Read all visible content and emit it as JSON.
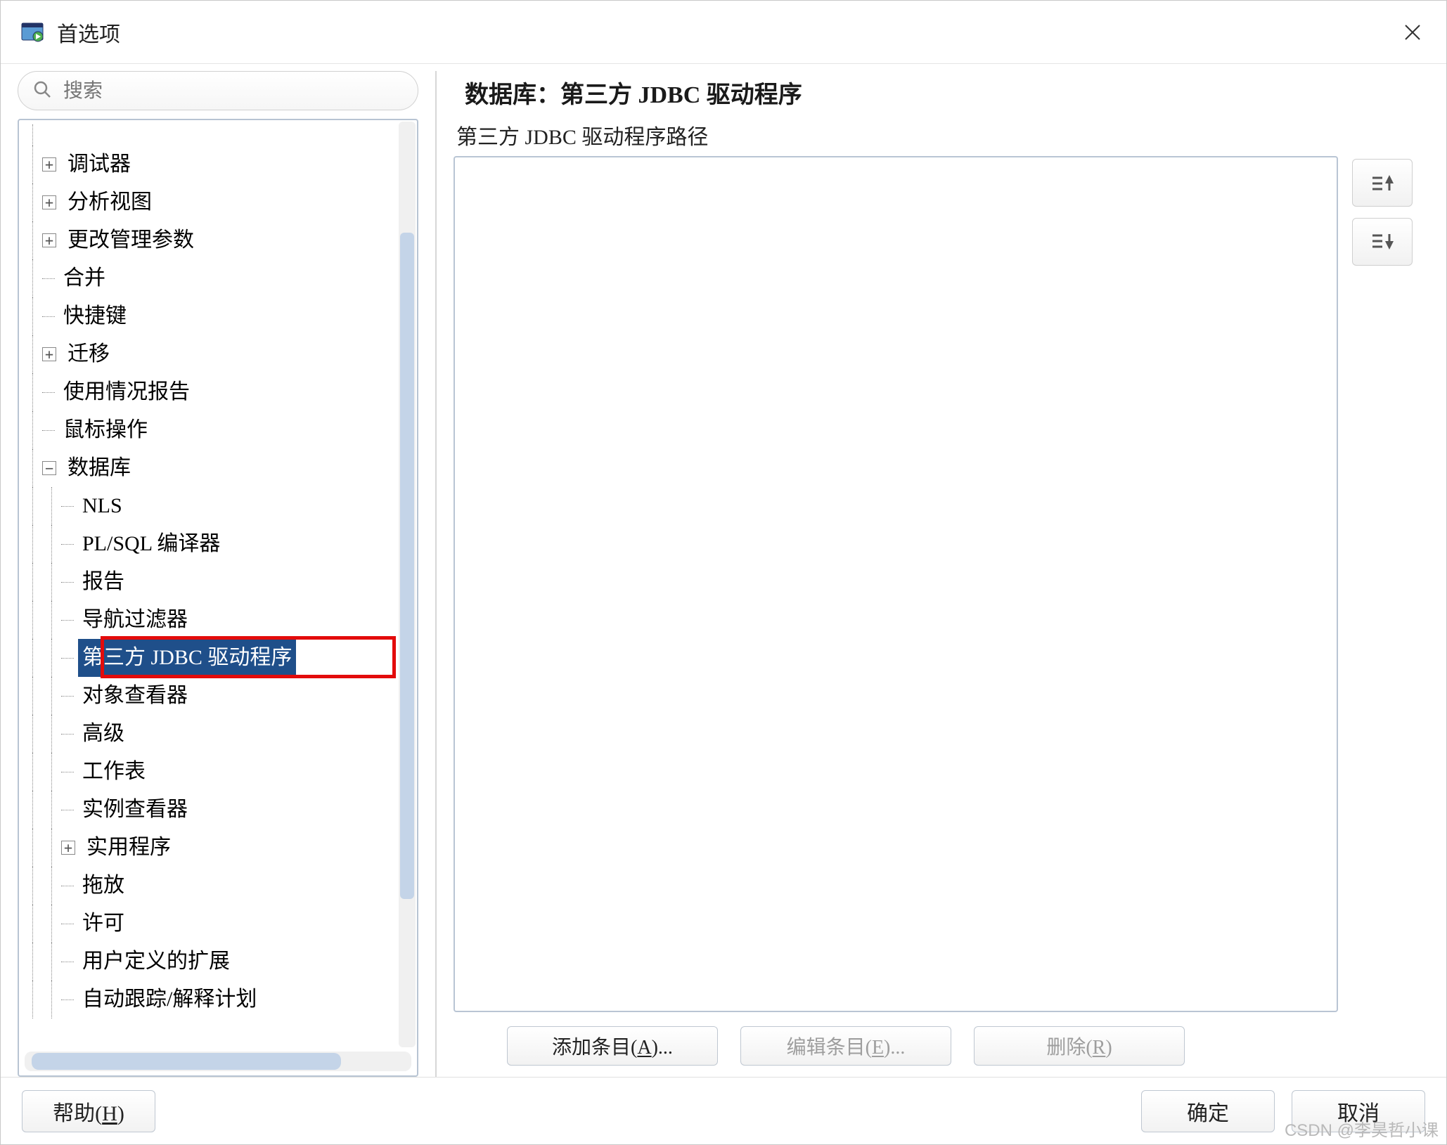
{
  "window": {
    "title": "首选项"
  },
  "search": {
    "placeholder": "搜索"
  },
  "tree": {
    "items": [
      {
        "level": 0,
        "toggle": "plus",
        "label": "调试器"
      },
      {
        "level": 0,
        "toggle": "plus",
        "label": "分析视图"
      },
      {
        "level": 0,
        "toggle": "plus",
        "label": "更改管理参数"
      },
      {
        "level": 0,
        "toggle": "none",
        "label": "合并"
      },
      {
        "level": 0,
        "toggle": "none",
        "label": "快捷键"
      },
      {
        "level": 0,
        "toggle": "plus",
        "label": "迁移"
      },
      {
        "level": 0,
        "toggle": "none",
        "label": "使用情况报告"
      },
      {
        "level": 0,
        "toggle": "none",
        "label": "鼠标操作"
      },
      {
        "level": 0,
        "toggle": "minus",
        "label": "数据库"
      },
      {
        "level": 1,
        "toggle": "none",
        "label": "NLS"
      },
      {
        "level": 1,
        "toggle": "none",
        "label": "PL/SQL 编译器"
      },
      {
        "level": 1,
        "toggle": "none",
        "label": "报告"
      },
      {
        "level": 1,
        "toggle": "none",
        "label": "导航过滤器"
      },
      {
        "level": 1,
        "toggle": "none",
        "label": "第三方 JDBC 驱动程序",
        "selected": true,
        "highlighted": true
      },
      {
        "level": 1,
        "toggle": "none",
        "label": "对象查看器"
      },
      {
        "level": 1,
        "toggle": "none",
        "label": "高级"
      },
      {
        "level": 1,
        "toggle": "none",
        "label": "工作表"
      },
      {
        "level": 1,
        "toggle": "none",
        "label": "实例查看器"
      },
      {
        "level": 1,
        "toggle": "plus",
        "label": "实用程序"
      },
      {
        "level": 1,
        "toggle": "none",
        "label": "拖放"
      },
      {
        "level": 1,
        "toggle": "none",
        "label": "许可"
      },
      {
        "level": 1,
        "toggle": "none",
        "label": "用户定义的扩展"
      },
      {
        "level": 1,
        "toggle": "none",
        "label": "自动跟踪/解释计划"
      }
    ],
    "cut_first_label": ""
  },
  "right": {
    "title": "数据库：第三方 JDBC 驱动程序",
    "subtitle": "第三方 JDBC 驱动程序路径",
    "buttons": {
      "add": "添加条目(A)...",
      "edit": "编辑条目(E)...",
      "delete": "删除(R)"
    }
  },
  "footer": {
    "help": "帮助(H)",
    "ok": "确定",
    "cancel": "取消"
  },
  "watermark": "CSDN @李昊哲小课"
}
